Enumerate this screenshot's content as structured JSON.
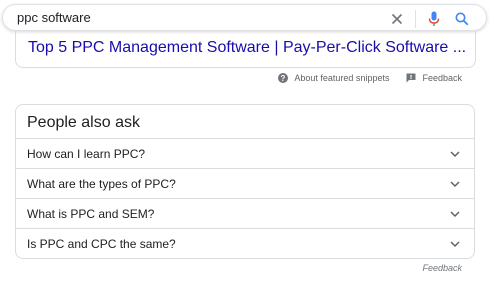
{
  "search": {
    "query": "ppc software"
  },
  "featured_snippet": {
    "title": "Top 5 PPC Management Software | Pay-Per-Click Software ...",
    "about_label": "About featured snippets",
    "feedback_label": "Feedback"
  },
  "people_also_ask": {
    "title": "People also ask",
    "questions": [
      {
        "text": "How can I learn PPC?"
      },
      {
        "text": "What are the types of PPC?"
      },
      {
        "text": "What is PPC and SEM?"
      },
      {
        "text": "Is PPC and CPC the same?"
      }
    ]
  },
  "footer": {
    "feedback_label": "Feedback"
  },
  "colors": {
    "link": "#1a0dab",
    "mic_blue": "#4285f4",
    "mic_red": "#ea4335",
    "search_blue": "#4285f4"
  }
}
